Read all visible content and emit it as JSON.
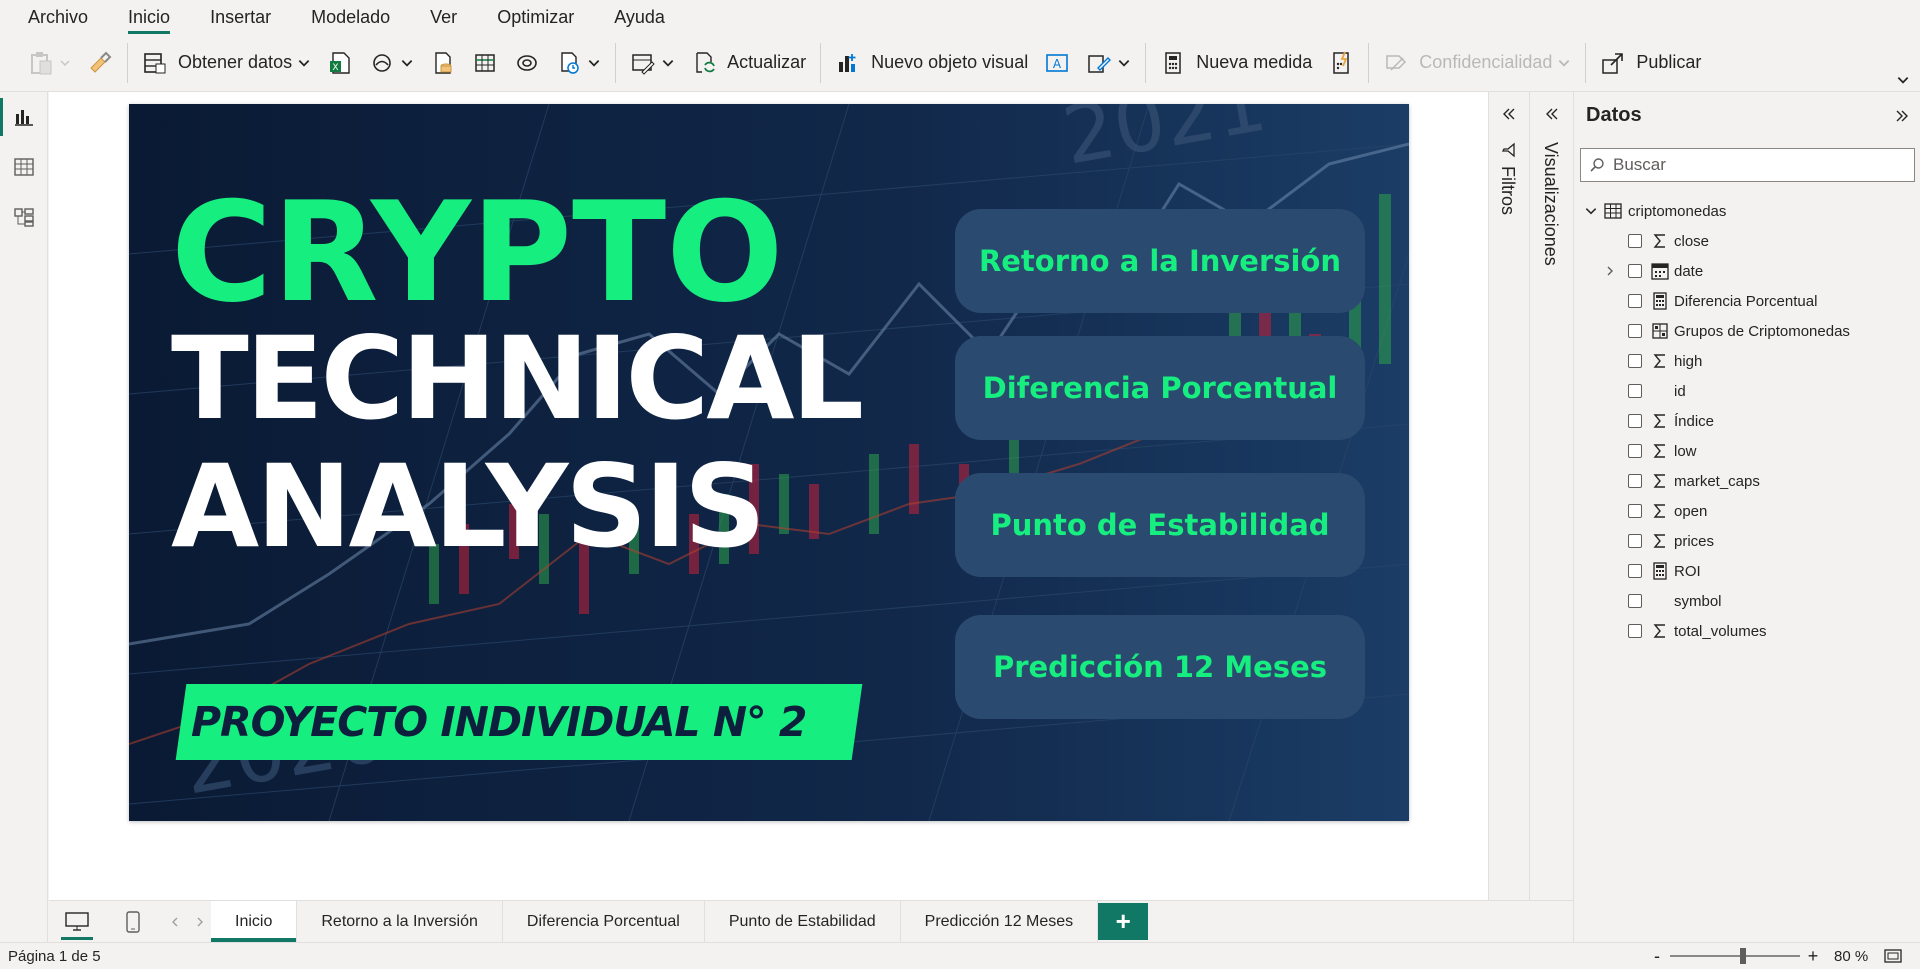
{
  "menu": {
    "items": [
      {
        "label": "Archivo",
        "active": false
      },
      {
        "label": "Inicio",
        "active": true
      },
      {
        "label": "Insertar",
        "active": false
      },
      {
        "label": "Modelado",
        "active": false
      },
      {
        "label": "Ver",
        "active": false
      },
      {
        "label": "Optimizar",
        "active": false
      },
      {
        "label": "Ayuda",
        "active": false
      }
    ]
  },
  "ribbon": {
    "obtener_datos": "Obtener datos",
    "actualizar": "Actualizar",
    "nuevo_objeto_visual": "Nuevo objeto visual",
    "nueva_medida": "Nueva medida",
    "confidencialidad": "Confidencialidad",
    "publicar": "Publicar"
  },
  "report": {
    "title_line1": "CRYPTO",
    "title_line2": "TECHNICAL",
    "title_line3": "ANALYSIS",
    "project_banner": "PROYECTO INDIVIDUAL N° 2",
    "nav_buttons": [
      "Retorno a la Inversión",
      "Diferencia Porcentual",
      "Punto de Estabilidad",
      "Predicción 12 Meses"
    ],
    "colors": {
      "background": "#0d1f3c",
      "accent": "#17ee80",
      "button": "#2b4a6f"
    }
  },
  "panes": {
    "filtros": "Filtros",
    "visualizaciones": "Visualizaciones"
  },
  "datos": {
    "title": "Datos",
    "search_placeholder": "Buscar",
    "table_name": "criptomonedas",
    "fields": [
      {
        "name": "close",
        "icon": "sigma-icon"
      },
      {
        "name": "date",
        "icon": "calendar-icon",
        "expandable": true
      },
      {
        "name": "Diferencia Porcentual",
        "icon": "calculator-icon"
      },
      {
        "name": "Grupos de Criptomonedas",
        "icon": "group-icon"
      },
      {
        "name": "high",
        "icon": "sigma-icon"
      },
      {
        "name": "id",
        "icon": "none"
      },
      {
        "name": "Índice",
        "icon": "sigma-icon"
      },
      {
        "name": "low",
        "icon": "sigma-icon"
      },
      {
        "name": "market_caps",
        "icon": "sigma-icon"
      },
      {
        "name": "open",
        "icon": "sigma-icon"
      },
      {
        "name": "prices",
        "icon": "sigma-icon"
      },
      {
        "name": "ROI",
        "icon": "calculator-icon"
      },
      {
        "name": "symbol",
        "icon": "none"
      },
      {
        "name": "total_volumes",
        "icon": "sigma-icon"
      }
    ]
  },
  "page_tabs": {
    "tabs": [
      {
        "label": "Inicio",
        "active": true
      },
      {
        "label": "Retorno a la Inversión",
        "active": false
      },
      {
        "label": "Diferencia Porcentual",
        "active": false
      },
      {
        "label": "Punto de Estabilidad",
        "active": false
      },
      {
        "label": "Predicción 12 Meses",
        "active": false
      }
    ],
    "add_label": "+"
  },
  "status": {
    "page_indicator": "Página 1 de 5",
    "zoom_minus": "-",
    "zoom_plus": "+",
    "zoom_percent": "80 %",
    "zoom_level": 0.8
  }
}
